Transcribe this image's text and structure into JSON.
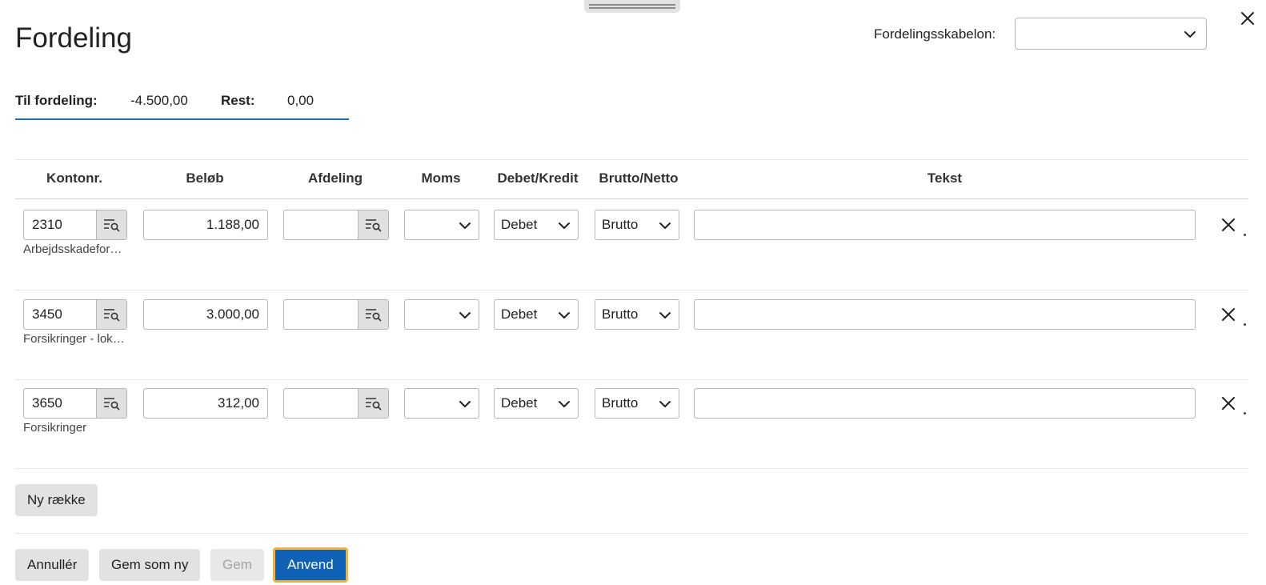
{
  "dialog": {
    "title": "Fordeling",
    "template_label": "Fordelingsskabelon:",
    "template_value": ""
  },
  "summary": {
    "to_distribute_label": "Til fordeling:",
    "to_distribute_value": "-4.500,00",
    "rest_label": "Rest:",
    "rest_value": "0,00"
  },
  "columns": [
    "Kontonr.",
    "Beløb",
    "Afdeling",
    "Moms",
    "Debet/Kredit",
    "Brutto/Netto",
    "Tekst"
  ],
  "rows": [
    {
      "account": "2310",
      "account_name": "Arbejdsskadeforsikring",
      "amount": "1.188,00",
      "department": "",
      "vat": "",
      "debit_credit": "Debet",
      "gross_net": "Brutto",
      "text": ""
    },
    {
      "account": "3450",
      "account_name": "Forsikringer - lokaler",
      "amount": "3.000,00",
      "department": "",
      "vat": "",
      "debit_credit": "Debet",
      "gross_net": "Brutto",
      "text": ""
    },
    {
      "account": "3650",
      "account_name": "Forsikringer",
      "amount": "312,00",
      "department": "",
      "vat": "",
      "debit_credit": "Debet",
      "gross_net": "Brutto",
      "text": ""
    }
  ],
  "buttons": {
    "new_row": "Ny række",
    "cancel": "Annullér",
    "save_as_new": "Gem som ny",
    "save": "Gem",
    "apply": "Anvend"
  },
  "colors": {
    "accent": "#0f62b5",
    "focus_ring": "#f5b335",
    "summary_underline": "#1f6fb5"
  },
  "icons": {
    "close": "close-icon",
    "lookup": "list-search-icon",
    "dropdown": "chevron-down-icon",
    "delete_row": "close-icon"
  }
}
